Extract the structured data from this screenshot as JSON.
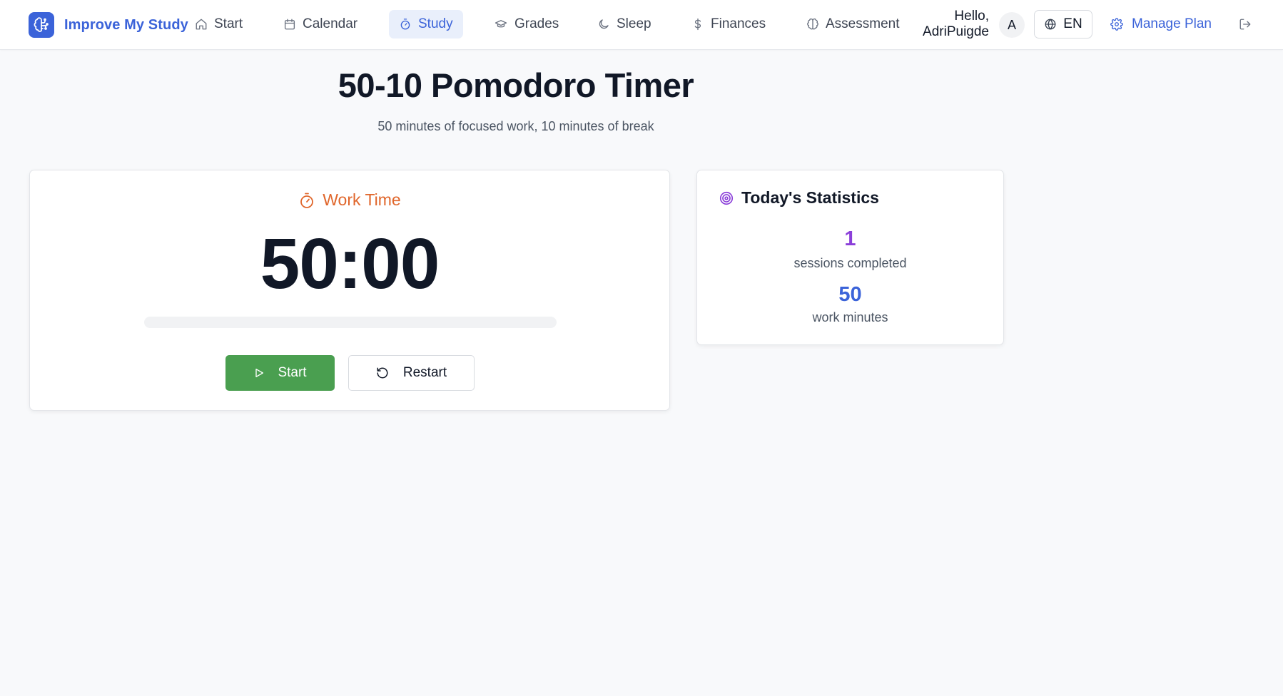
{
  "brand": {
    "name": "Improve My Study",
    "logo_icon": "brain-icon",
    "logo_color": "#3b63d9"
  },
  "nav": {
    "items": [
      {
        "label": "Start",
        "icon": "home-icon",
        "active": false
      },
      {
        "label": "Calendar",
        "icon": "calendar-icon",
        "active": false
      },
      {
        "label": "Study",
        "icon": "timer-icon",
        "active": true
      },
      {
        "label": "Grades",
        "icon": "graduation-cap-icon",
        "active": false
      },
      {
        "label": "Sleep",
        "icon": "moon-icon",
        "active": false
      },
      {
        "label": "Finances",
        "icon": "dollar-icon",
        "active": false
      },
      {
        "label": "Assessment",
        "icon": "brain-icon",
        "active": false
      }
    ]
  },
  "user": {
    "greeting_line1": "Hello,",
    "greeting_line2": "AdriPuigde",
    "avatar_initial": "A"
  },
  "language": {
    "code": "EN",
    "icon": "globe-icon"
  },
  "manage_plan": {
    "label": "Manage Plan",
    "icon": "gear-icon"
  },
  "logout": {
    "icon": "logout-icon"
  },
  "page": {
    "title": "50-10 Pomodoro Timer",
    "subtitle": "50 minutes of focused work, 10 minutes of break"
  },
  "timer": {
    "mode_label": "Work Time",
    "mode_icon": "stopwatch-icon",
    "display": "50:00",
    "progress_fraction": 0,
    "start_label": "Start",
    "restart_label": "Restart"
  },
  "stats": {
    "title": "Today's Statistics",
    "icon": "target-icon",
    "sessions_value": "1",
    "sessions_label": "sessions completed",
    "minutes_value": "50",
    "minutes_label": "work minutes"
  },
  "colors": {
    "accent": "#3b63d9",
    "work": "#e0662b",
    "start_button": "#4a9f50",
    "sessions_value": "#8b3fd9",
    "minutes_value": "#3b63d9"
  }
}
